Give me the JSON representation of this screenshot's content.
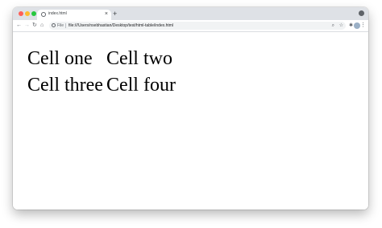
{
  "browser": {
    "tab_title": "index.html",
    "tab_close": "×",
    "new_tab": "+",
    "scheme_label": "File",
    "url": "file:///Users/nsebhastian/Desktop/test/html-table/index.html"
  },
  "toolbar": {
    "back": "←",
    "forward": "→",
    "reload": "↻",
    "home": "⌂",
    "zoom": "⌕",
    "bookmark": "☆",
    "extensions": "✱",
    "menu": "⋮"
  },
  "table": {
    "rows": [
      [
        "Cell one",
        "Cell two"
      ],
      [
        "Cell three",
        "Cell four"
      ]
    ]
  },
  "colors": {
    "titlebar": "#dee1e6",
    "close": "#fe5f57",
    "minimize": "#febc2e",
    "maximize": "#28c840"
  },
  "icons": [
    "back-icon",
    "forward-icon",
    "reload-icon",
    "home-icon",
    "info-icon",
    "zoom-icon",
    "bookmark-star-icon",
    "extensions-icon",
    "menu-icon"
  ]
}
